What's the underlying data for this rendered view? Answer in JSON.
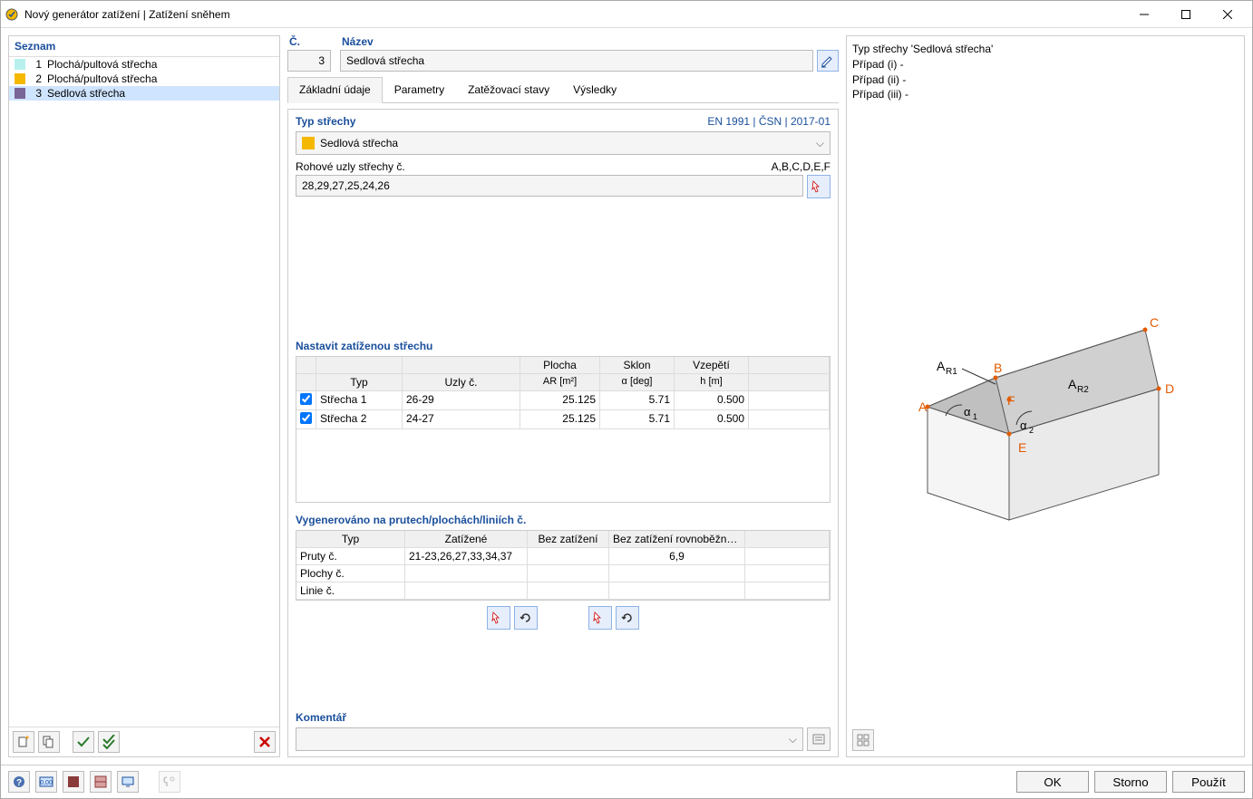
{
  "window": {
    "title": "Nový generátor zatížení | Zatížení sněhem"
  },
  "sidebar": {
    "header": "Seznam",
    "items": [
      {
        "num": "1",
        "label": "Plochá/pultová střecha",
        "color": "#b8f0ee"
      },
      {
        "num": "2",
        "label": "Plochá/pultová střecha",
        "color": "#f5b800"
      },
      {
        "num": "3",
        "label": "Sedlová střecha",
        "color": "#7a6599"
      }
    ]
  },
  "top": {
    "num_label": "Č.",
    "num_value": "3",
    "name_label": "Název",
    "name_value": "Sedlová střecha"
  },
  "tabs": [
    "Základní údaje",
    "Parametry",
    "Zatěžovací stavy",
    "Výsledky"
  ],
  "roof_type": {
    "title": "Typ střechy",
    "meta": "EN 1991 | ČSN | 2017-01",
    "value": "Sedlová střecha",
    "corners_label": "Rohové uzly střechy č.",
    "corners_hint": "A,B,C,D,E,F",
    "corners_value": "28,29,27,25,24,26"
  },
  "loaded_roof": {
    "title": "Nastavit zatíženou střechu",
    "headers": {
      "typ": "Typ",
      "uzly": "Uzly č.",
      "plocha1": "Plocha",
      "plocha2": "AR [m²]",
      "sklon1": "Sklon",
      "sklon2": "α [deg]",
      "vzep1": "Vzepětí",
      "vzep2": "h [m]"
    },
    "rows": [
      {
        "chk": true,
        "typ": "Střecha 1",
        "uzly": "26-29",
        "ar": "25.125",
        "sklon": "5.71",
        "vzep": "0.500"
      },
      {
        "chk": true,
        "typ": "Střecha 2",
        "uzly": "24-27",
        "ar": "25.125",
        "sklon": "5.71",
        "vzep": "0.500"
      }
    ]
  },
  "generated": {
    "title": "Vygenerováno na prutech/plochách/liniích č.",
    "headers": {
      "typ": "Typ",
      "zat": "Zatížené",
      "bz": "Bez zatížení",
      "bzr": "Bez zatížení rovnoběžně s"
    },
    "rows": [
      {
        "typ": "Pruty č.",
        "zat": "21-23,26,27,33,34,37",
        "bz": "",
        "bzr": "6,9"
      },
      {
        "typ": "Plochy č.",
        "zat": "",
        "bz": "",
        "bzr": ""
      },
      {
        "typ": "Linie č.",
        "zat": "",
        "bz": "",
        "bzr": ""
      }
    ]
  },
  "comment": {
    "title": "Komentář",
    "value": ""
  },
  "info": {
    "line1": "Typ střechy 'Sedlová střecha'",
    "line2": "Případ (i) -",
    "line3": "Případ (ii) -",
    "line4": "Případ (iii) -"
  },
  "buttons": {
    "ok": "OK",
    "cancel": "Storno",
    "apply": "Použít"
  }
}
